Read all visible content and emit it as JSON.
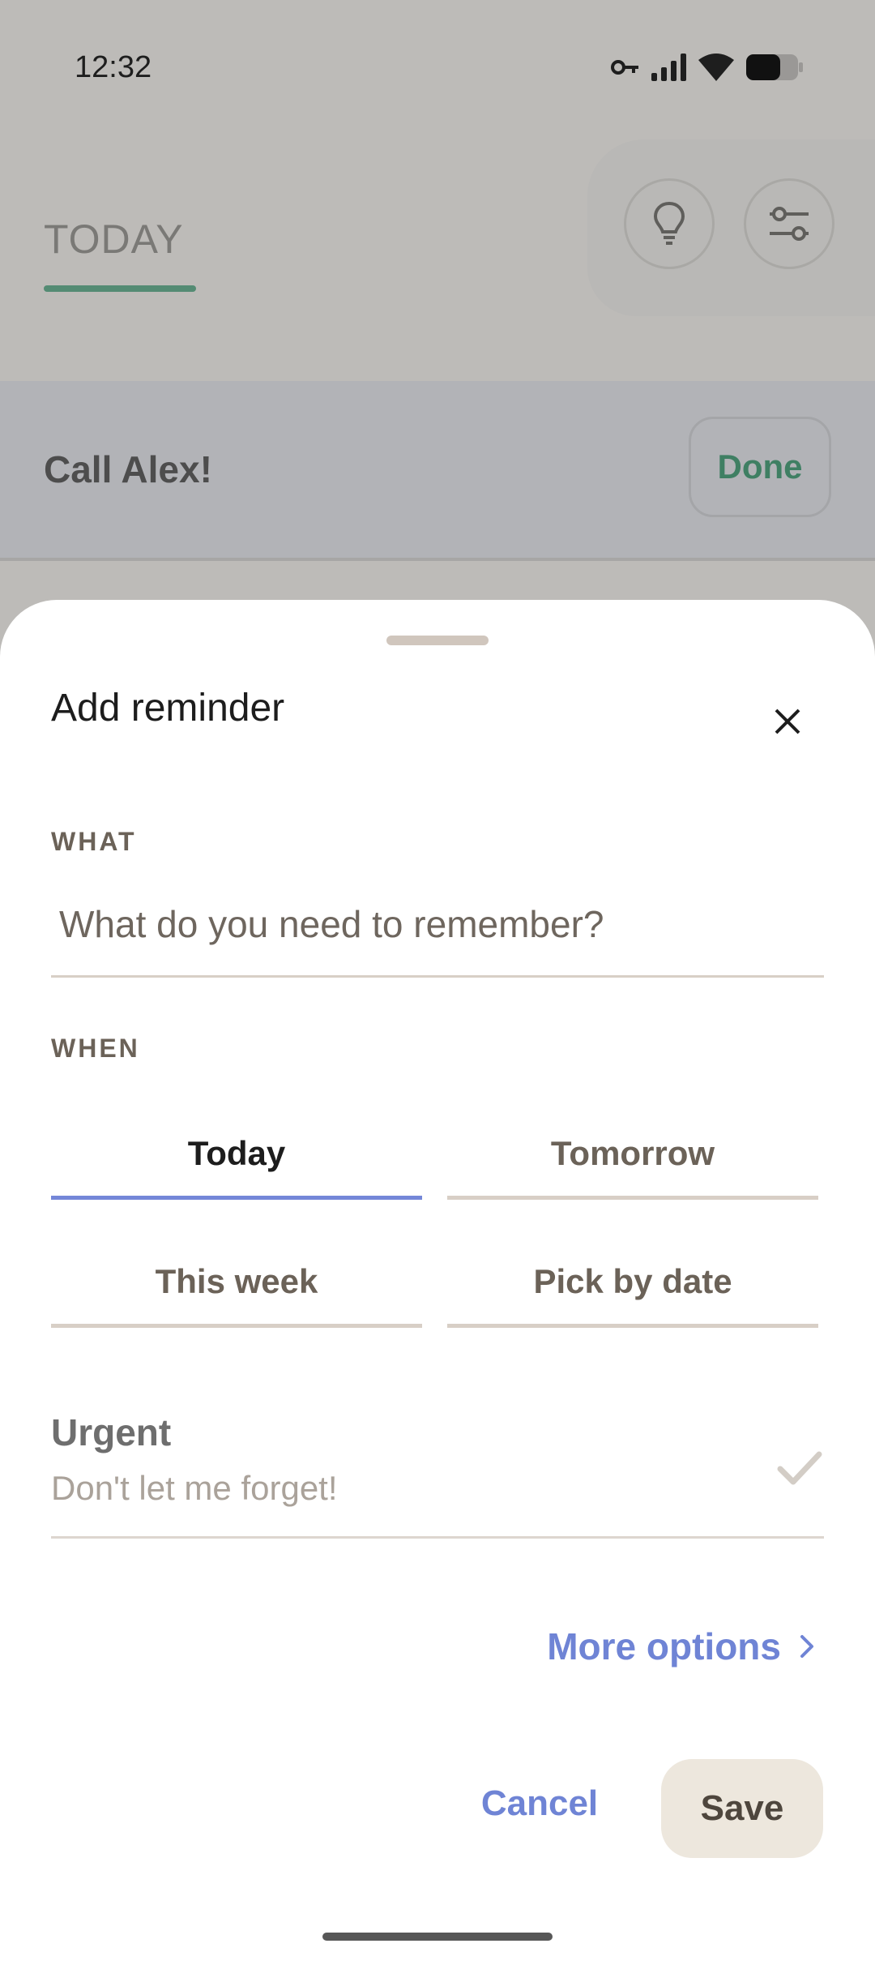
{
  "status_bar": {
    "time": "12:32",
    "icons": [
      "vpn-key-icon",
      "signal-icon",
      "wifi-icon",
      "battery-icon"
    ]
  },
  "background": {
    "tab_label": "TODAY",
    "header_buttons": [
      "lightbulb-icon",
      "filter-settings-icon"
    ],
    "reminder_text": "Call Alex!",
    "done_label": "Done",
    "accent_color": "#3a7f62"
  },
  "sheet": {
    "title": "Add reminder",
    "what_label": "WHAT",
    "what_placeholder": "What do you need to remember?",
    "what_value": "",
    "when_label": "WHEN",
    "when_options": [
      {
        "label": "Today",
        "selected": true
      },
      {
        "label": "Tomorrow",
        "selected": false
      },
      {
        "label": "This week",
        "selected": false
      },
      {
        "label": "Pick by date",
        "selected": false
      }
    ],
    "urgent_title": "Urgent",
    "urgent_subtitle": "Don't let me forget!",
    "urgent_checked": false,
    "more_options_label": "More options",
    "cancel_label": "Cancel",
    "save_label": "Save",
    "accent_color": "#6f84d5"
  }
}
